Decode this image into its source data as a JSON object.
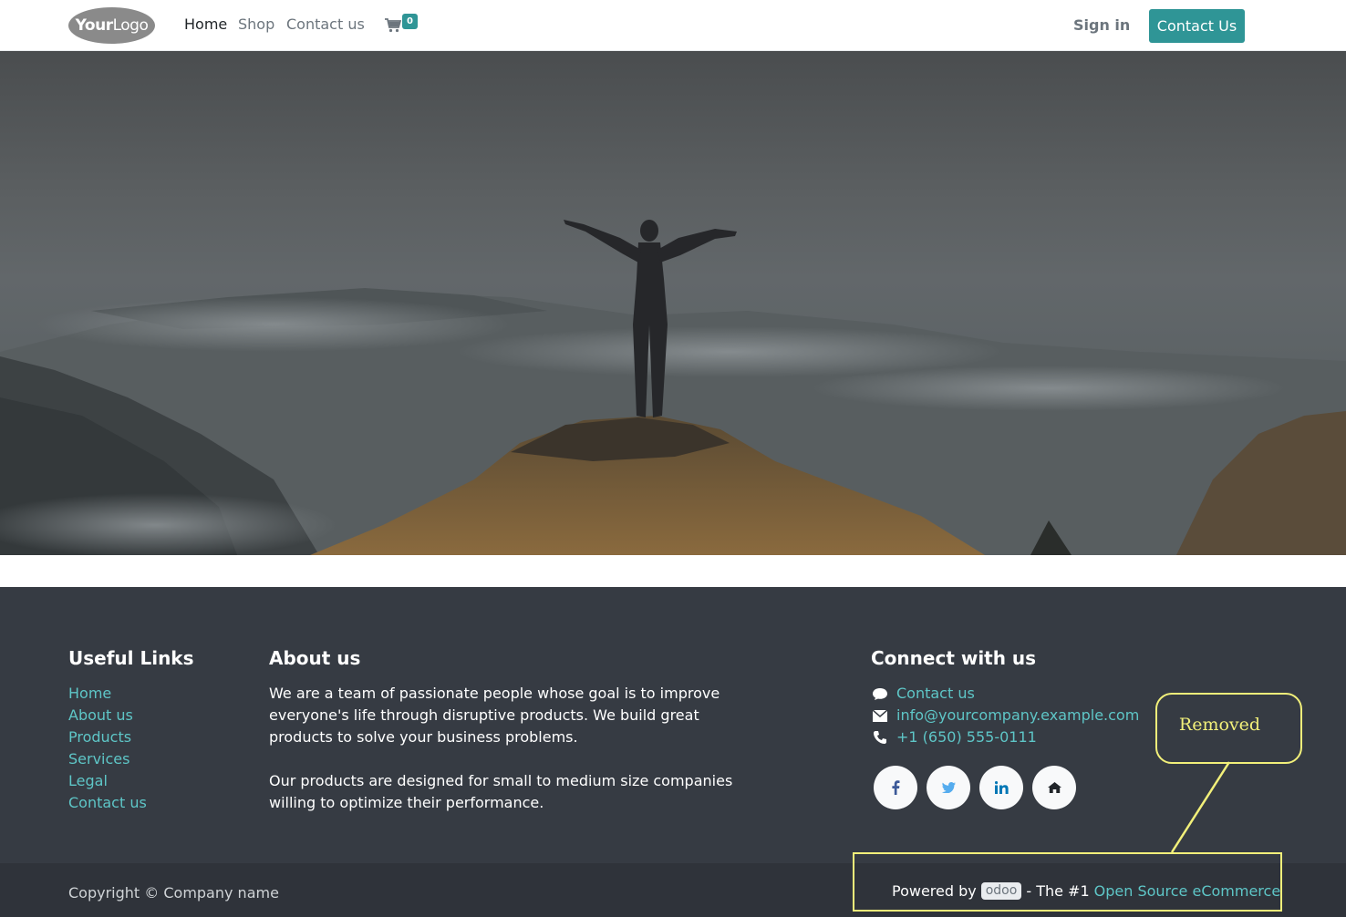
{
  "header": {
    "logo": {
      "bold": "Your",
      "light": "Logo"
    },
    "nav": [
      {
        "label": "Home",
        "active": true
      },
      {
        "label": "Shop",
        "active": false
      },
      {
        "label": "Contact us",
        "active": false
      }
    ],
    "cart_count": "0",
    "signin_label": "Sign in",
    "cta_label": "Contact Us"
  },
  "footer": {
    "useful_links": {
      "title": "Useful Links",
      "items": [
        "Home",
        "About us",
        "Products",
        "Services",
        "Legal",
        "Contact us"
      ]
    },
    "about": {
      "title": "About us",
      "paragraphs": [
        "We are a team of passionate people whose goal is to improve everyone's life through disruptive products. We build great products to solve your business problems.",
        "Our products are designed for small to medium size companies willing to optimize their performance."
      ]
    },
    "connect": {
      "title": "Connect with us",
      "items": [
        {
          "icon": "comment-icon",
          "label": "Contact us"
        },
        {
          "icon": "envelope-icon",
          "label": "info@yourcompany.example.com"
        },
        {
          "icon": "phone-icon",
          "label": "+1 (650) 555-0111"
        }
      ],
      "social": [
        "facebook-icon",
        "twitter-icon",
        "linkedin-icon",
        "home-icon"
      ]
    }
  },
  "bottom": {
    "copyright": "Copyright © Company name",
    "powered_prefix": "Powered by",
    "odoo": "odoo",
    "powered_mid": "- The #1",
    "powered_link": "Open Source eCommerce"
  },
  "annotation": {
    "callout_text": "Removed"
  },
  "colors": {
    "accent": "#2f9596",
    "link": "#5ec6c7",
    "footer_bg": "#363b43",
    "annotation": "#f2f07a"
  }
}
